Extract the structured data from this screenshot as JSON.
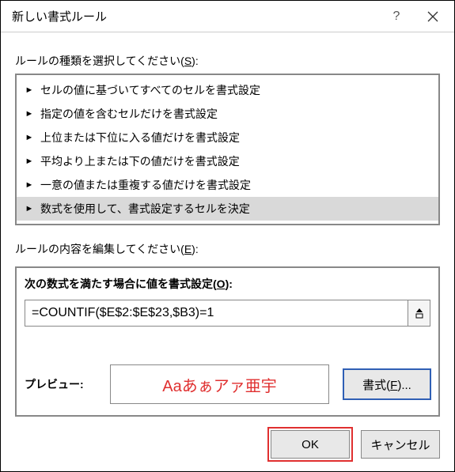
{
  "titlebar": {
    "title": "新しい書式ルール",
    "help_label": "?",
    "close_label": "×"
  },
  "select_rule_type": {
    "label_pre": "ルールの種類を選択してください(",
    "access": "S",
    "label_post": "):",
    "items": [
      "セルの値に基づいてすべてのセルを書式設定",
      "指定の値を含むセルだけを書式設定",
      "上位または下位に入る値だけを書式設定",
      "平均より上または下の値だけを書式設定",
      "一意の値または重複する値だけを書式設定",
      "数式を使用して、書式設定するセルを決定"
    ],
    "selected_index": 5
  },
  "edit_rule": {
    "label_pre": "ルールの内容を編集してください(",
    "access": "E",
    "label_post": "):",
    "formula_label_pre": "次の数式を満たす場合に値を書式設定(",
    "formula_access": "O",
    "formula_label_post": "):",
    "formula_value": "=COUNTIF($E$2:$E$23,$B3)=1",
    "preview_label": "プレビュー:",
    "preview_text": "Aaあぁアァ亜宇",
    "format_btn_pre": "書式(",
    "format_access": "F",
    "format_btn_post": ")..."
  },
  "buttons": {
    "ok": "OK",
    "cancel": "キャンセル"
  }
}
